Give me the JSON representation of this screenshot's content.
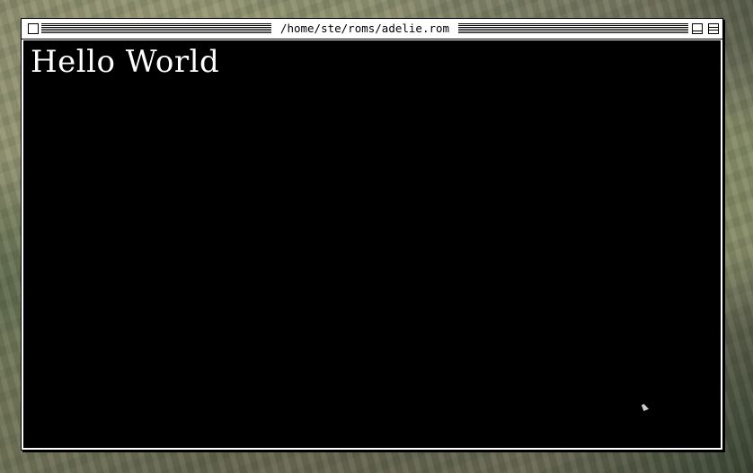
{
  "window": {
    "title": "/home/ste/roms/adelie.rom",
    "controls": {
      "close": "close-box-icon",
      "zoom": "zoom-box-icon",
      "shade": "shade-box-icon"
    }
  },
  "screen": {
    "output_text": "Hello World",
    "background_color": "#000000",
    "text_color": "#ffffff"
  },
  "cursor": {
    "icon": "mouse-pointer-icon"
  }
}
